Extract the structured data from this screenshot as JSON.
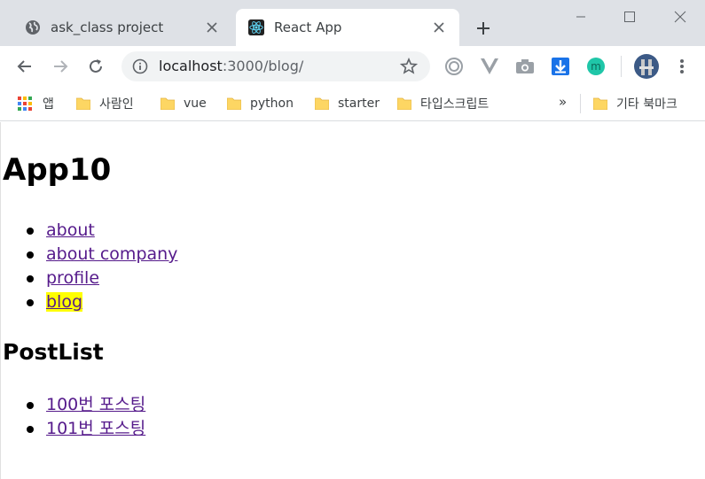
{
  "tabs": [
    {
      "title": "ask_class project",
      "favicon": "globe-icon",
      "active": false
    },
    {
      "title": "React App",
      "favicon": "react-icon",
      "active": true
    }
  ],
  "window_controls": [
    "minimize-icon",
    "maximize-icon",
    "close-icon"
  ],
  "address_bar": {
    "host": "localhost",
    "port_path": ":3000/blog/"
  },
  "bookmarks": {
    "apps_label": "앱",
    "items": [
      "사람인",
      "vue",
      "python",
      "starter",
      "타입스크립트"
    ],
    "more": "»",
    "other": "기타 북마크"
  },
  "page": {
    "title": "App10",
    "nav_links": [
      {
        "label": "about",
        "highlighted": false
      },
      {
        "label": "about company",
        "highlighted": false
      },
      {
        "label": "profile",
        "highlighted": false
      },
      {
        "label": "blog",
        "highlighted": true
      }
    ],
    "section_title": "PostList",
    "posts": [
      "100번 포스팅",
      "101번 포스팅"
    ]
  },
  "colors": {
    "tabstrip": "#dee1e6",
    "link": "#551a8b",
    "highlight": "#ffff00"
  }
}
